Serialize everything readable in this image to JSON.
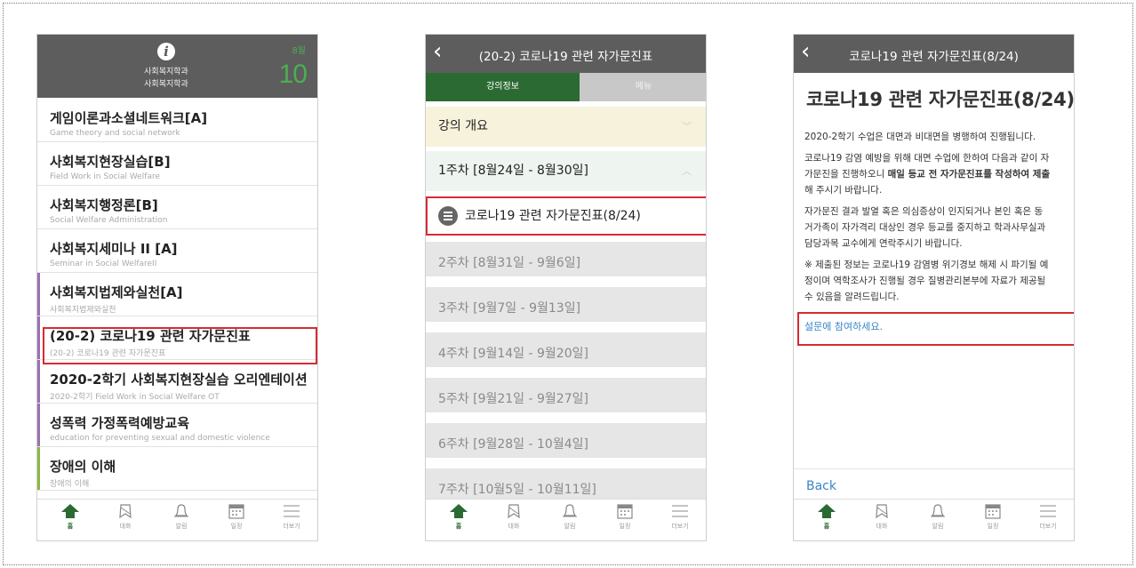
{
  "tabs": [
    {
      "label": "홈",
      "icon": "home-icon"
    },
    {
      "label": "대화",
      "icon": "chat-icon"
    },
    {
      "label": "알림",
      "icon": "bell-icon"
    },
    {
      "label": "일정",
      "icon": "calendar-icon"
    },
    {
      "label": "더보기",
      "icon": "menu-icon"
    }
  ],
  "colors": {
    "accent": "#2b6b33",
    "header": "#5d5d5d",
    "highlight": "#d62b33",
    "link": "#3a86c8"
  },
  "screen1": {
    "dept_line1": "사회복지학과",
    "dept_line2": "사회복지학과",
    "month": "8월",
    "day": "10",
    "courses": [
      {
        "title": "게임이론과소셜네트워크[A]",
        "subtitle": "Game theory and social network"
      },
      {
        "title": "사회복지현장실습[B]",
        "subtitle": "Field Work in Social Welfare"
      },
      {
        "title": "사회복지행정론[B]",
        "subtitle": "Social Welfare Administration"
      },
      {
        "title": "사회복지세미나 II [A]",
        "subtitle": "Seminar in Social WelfareII"
      },
      {
        "title": "사회복지법제와실천[A]",
        "subtitle": "사회복지법제와실천"
      },
      {
        "title": "(20-2) 코로나19 관련 자가문진표",
        "subtitle": "(20-2) 코로나19 관련 자가문진표"
      },
      {
        "title": "2020-2학기 사회복지현장실습 오리엔테이션",
        "subtitle": "2020-2학기 Field Work in Social Welfare OT"
      },
      {
        "title": "성폭력 가정폭력예방교육",
        "subtitle": "education for preventing sexual and domestic violence"
      },
      {
        "title": "장애의 이해",
        "subtitle": "장애의 이해"
      }
    ]
  },
  "screen2": {
    "title": "(20-2) 코로나19 관련 자가문진표",
    "seg_info": "강의정보",
    "seg_menu": "메뉴",
    "overview": "강의 개요",
    "week1": "1주차 [8월24일 - 8월30일]",
    "item": "코로나19 관련 자가문진표(8/24)",
    "weeks": [
      "2주차 [8월31일 - 9월6일]",
      "3주차 [9월7일 - 9월13일]",
      "4주차 [9월14일 - 9월20일]",
      "5주차 [9월21일 - 9월27일]",
      "6주차 [9월28일 - 10월4일]",
      "7주차 [10월5일 - 10월11일]"
    ]
  },
  "screen3": {
    "nav_title": "코로나19 관련 자가문진표(8/24)",
    "heading": "코로나19 관련 자가문진표(8/24)",
    "p1": "2020-2학기 수업은 대면과 비대면을 병행하여 진행됩니다.",
    "p2a_l1": "코로나19 감염 예방을 위해 대면 수업에 한하여 다음과 같이 자",
    "p2a_l2": "가문진을 진행하오니 ",
    "p2b_bold": "매일 등교 전 자가문진표를 작성하여 제출",
    "p2c_l3": "해 주시기 바랍니다.",
    "p3_l1": "자가문진 결과 발열 혹은 의심증상이 인지되거나 본인 혹은 동",
    "p3_l2": "거가족이 자가격리 대상인 경우 등교를 중지하고 학과사무실과",
    "p3_l3": "담당과목 교수에게 연락주시기 바랍니다.",
    "p4_l1": "※ 제출된 정보는 코로나19 감염병 위기경보 해제 시 파기될 예",
    "p4_l2": "정이며 역학조사가 진행될 경우 질병관리본부에 자료가 제공될",
    "p4_l3": "수 있음을 알려드립니다.",
    "link": "설문에 참여하세요.",
    "back": "Back"
  }
}
